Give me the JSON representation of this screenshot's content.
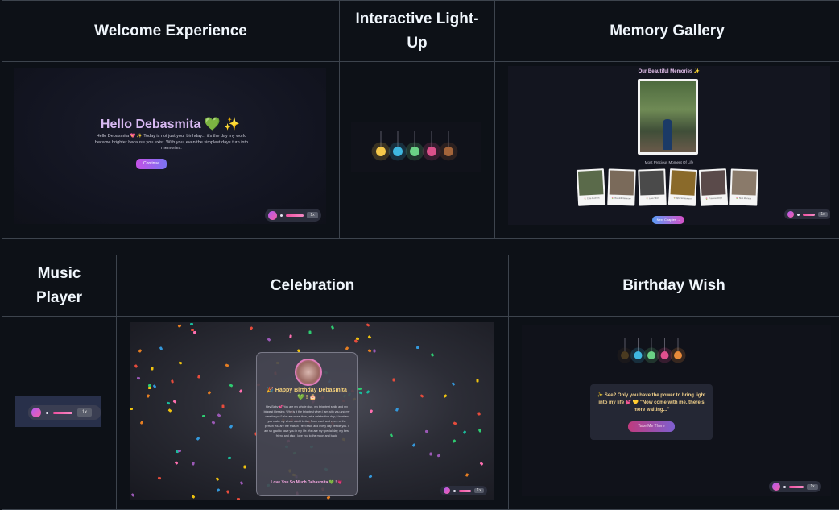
{
  "table": {
    "row1_headers": [
      "Welcome Experience",
      "Interactive Light-Up",
      "Memory Gallery"
    ],
    "row2_headers": [
      "Music Player",
      "Celebration",
      "Birthday Wish"
    ]
  },
  "welcome": {
    "title": "Hello Debasmita 💚 ✨",
    "body": "Hello Debasmita 💖 ✨ Today is not just your birthday... it's the day my world became brighter because you exist. With you, even the simplest days turn into memories.",
    "button": "Continue"
  },
  "lightup": {
    "bulb_colors": [
      "#f5c84a",
      "#3fb7e0",
      "#6bd186",
      "#d9508a",
      "#a4653a"
    ]
  },
  "gallery": {
    "title": "Our Beautiful Memories ✨",
    "subtitle": "Most Precious Moment Of Life",
    "thumb_captions": [
      "🌷 Cute Moment",
      "🌷 Beautiful Memory",
      "🌷 Love Vibes",
      "🌷 Special Moment",
      "🌷 Precious Days",
      "🌷 Best Memory"
    ],
    "button": "Next Chapter →"
  },
  "player": {
    "speed_label": "1x"
  },
  "celebration": {
    "title": "🎉 Happy Birthday Debasmita 💚 ! 🎂",
    "message": "Hey Baby 💕 You are my whole glue, my brightest smile and my biggest blessing. Why is it the brightest when I am with you and my care for you? You are more than just a celebration day; it is when you make my whole world better. From each and every of the person you are the reason I feel each and every day beside you. I am so glad to have you in my life. You are my special day, my best friend and also I love you to the moon and back!",
    "footer": "Love You So Much Debasmita 💚 ! 💗"
  },
  "wish": {
    "message": "✨ See? Only you have the power to bring light into my life 💕 💛 \"Now come with me, there's more waiting...\"",
    "button": "Take Me There",
    "bulb_colors": [
      "#4a3a20",
      "#3fb7e0",
      "#6bd186",
      "#e24f8e",
      "#e88a3a"
    ]
  },
  "colors": {
    "page_bg": "#0d1117",
    "border": "#3d444d",
    "accent_gradient_start": "#b15bf0",
    "accent_gradient_end": "#f45fa6"
  }
}
